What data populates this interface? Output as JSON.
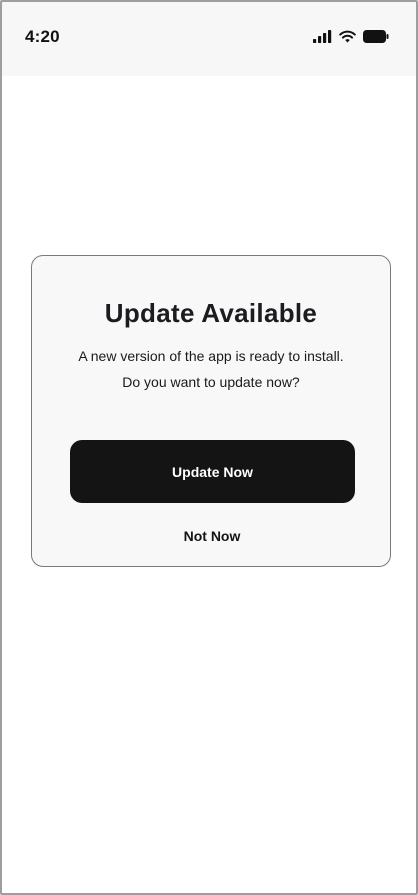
{
  "status_bar": {
    "time": "4:20",
    "icons": [
      "cellular-signal-icon",
      "wifi-icon",
      "battery-icon"
    ]
  },
  "dialog": {
    "title": "Update Available",
    "message_line_1": "A new version of the app is ready to install.",
    "message_line_2": "Do you want to update now?",
    "primary_label": "Update Now",
    "secondary_label": "Not Now"
  },
  "colors": {
    "status_bar_bg": "#f7f7f7",
    "dialog_bg": "#f8f8f8",
    "primary_button_bg": "#141414",
    "primary_button_text": "#ffffff",
    "text": "#111111"
  }
}
